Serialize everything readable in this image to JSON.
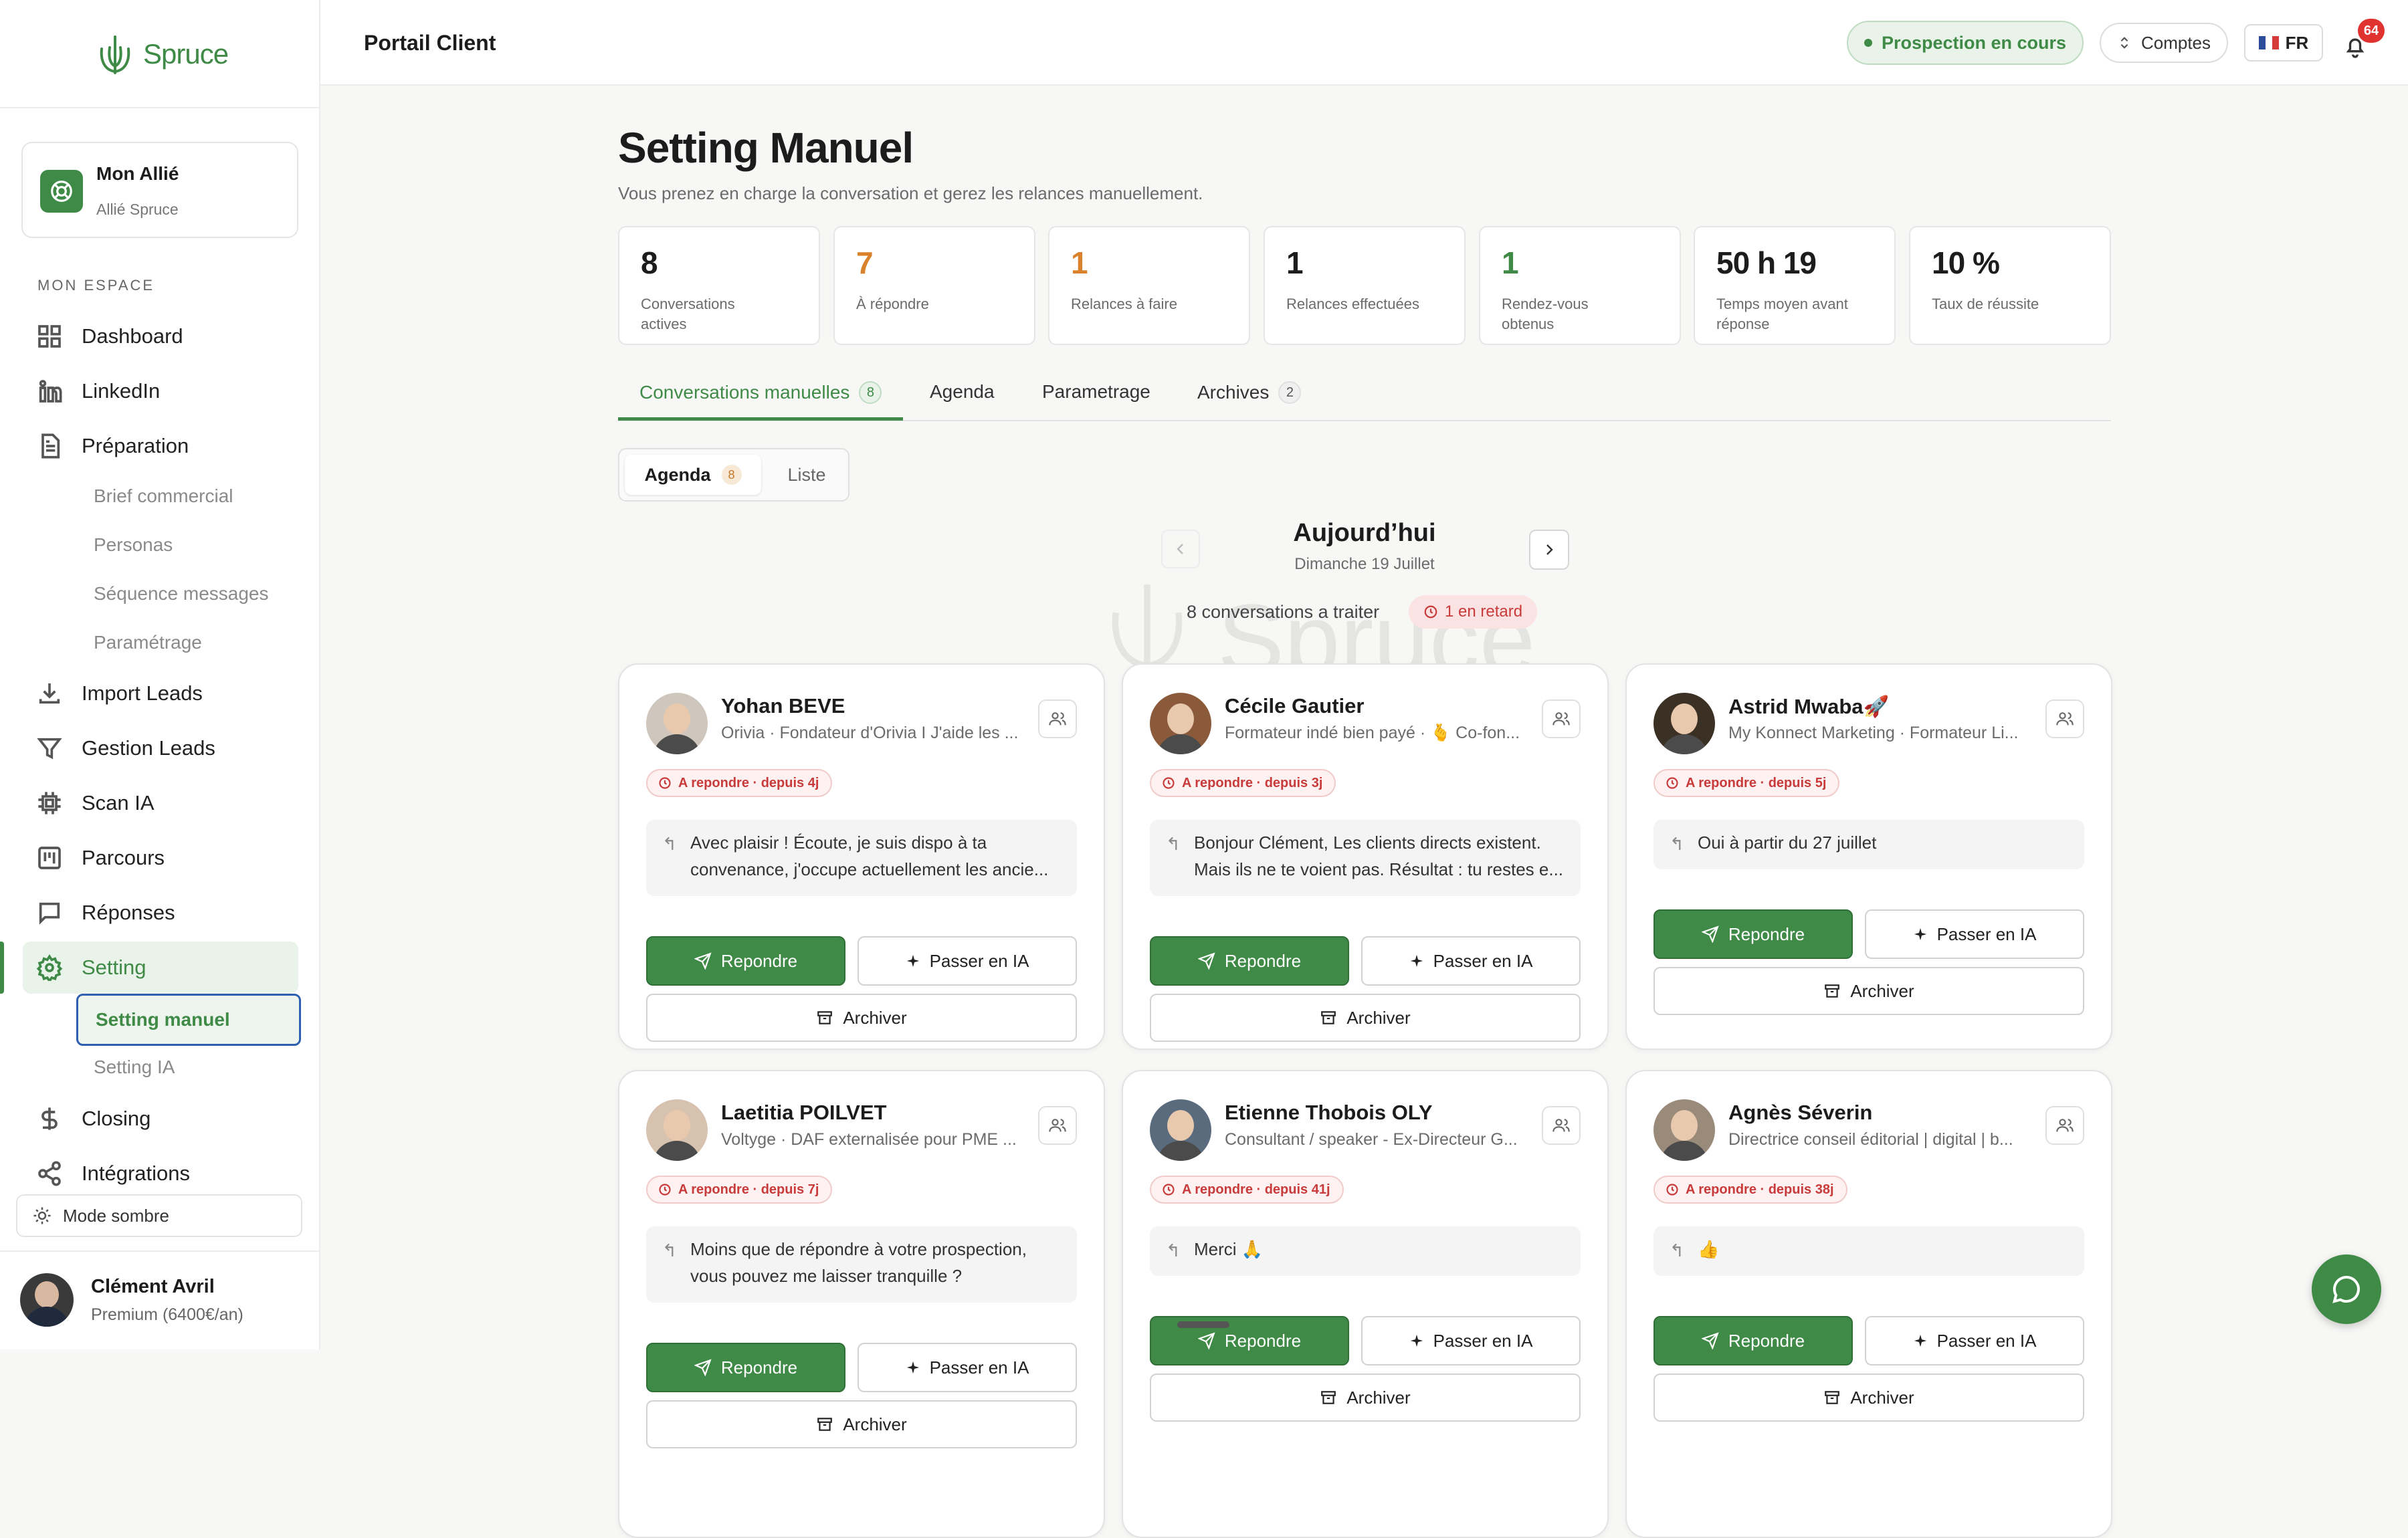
{
  "sidebar": {
    "logo_text": "Spruce",
    "ally": {
      "name": "Mon Allié",
      "sub": "Allié Spruce"
    },
    "section_label": "MON ESPACE",
    "items": [
      {
        "label": "Dashboard",
        "icon": "grid-icon"
      },
      {
        "label": "LinkedIn",
        "icon": "linkedin-icon"
      },
      {
        "label": "Préparation",
        "icon": "document-icon"
      },
      {
        "label": "Import Leads",
        "icon": "download-icon"
      },
      {
        "label": "Gestion Leads",
        "icon": "filter-icon"
      },
      {
        "label": "Scan IA",
        "icon": "chip-icon"
      },
      {
        "label": "Parcours",
        "icon": "kanban-icon"
      },
      {
        "label": "Réponses",
        "icon": "chat-icon"
      },
      {
        "label": "Setting",
        "icon": "gear-icon"
      },
      {
        "label": "Closing",
        "icon": "dollar-icon"
      },
      {
        "label": "Intégrations",
        "icon": "share-icon"
      }
    ],
    "prep_subitems": [
      "Brief commercial",
      "Personas",
      "Séquence messages",
      "Paramétrage"
    ],
    "setting_subitems": [
      "Setting manuel",
      "Setting IA"
    ],
    "dark_mode": "Mode sombre",
    "user": {
      "name": "Clément Avril",
      "plan": "Premium (6400€/an)"
    }
  },
  "topbar": {
    "title": "Portail Client",
    "status": "Prospection en cours",
    "accounts": "Comptes",
    "lang": "FR",
    "notif_count": "64"
  },
  "page": {
    "title": "Setting Manuel",
    "subtitle": "Vous prenez en charge la conversation et gerez les relances manuellement."
  },
  "stats": [
    {
      "value": "8",
      "label": "Conversations actives",
      "color": "#1c1c1c"
    },
    {
      "value": "7",
      "label": "À répondre",
      "color": "#d9822b"
    },
    {
      "value": "1",
      "label": "Relances à faire",
      "color": "#d9822b"
    },
    {
      "value": "1",
      "label": "Relances effectuées",
      "color": "#1c1c1c"
    },
    {
      "value": "1",
      "label": "Rendez-vous obtenus",
      "color": "#3f8a46"
    },
    {
      "value": "50 h 19",
      "label": "Temps moyen avant réponse",
      "color": "#1c1c1c"
    },
    {
      "value": "10 %",
      "label": "Taux de réussite",
      "color": "#1c1c1c"
    }
  ],
  "tabs": [
    {
      "label": "Conversations manuelles",
      "badge": "8"
    },
    {
      "label": "Agenda"
    },
    {
      "label": "Parametrage"
    },
    {
      "label": "Archives",
      "badge": "2"
    }
  ],
  "view_toggle": {
    "agenda": "Agenda",
    "agenda_badge": "8",
    "liste": "Liste"
  },
  "day": {
    "title": "Aujourd’hui",
    "date": "Dimanche 19 Juillet",
    "count": "8 conversations a traiter",
    "late": "1 en retard"
  },
  "actions": {
    "reply": "Repondre",
    "ia": "Passer en IA",
    "archive": "Archiver"
  },
  "cards": [
    {
      "name": "Yohan BEVE",
      "sub": "Orivia · Fondateur d'Orivia I J'aide les ...",
      "badge": "A repondre · depuis 4j",
      "message": "Avec plaisir ! Écoute, je suis dispo à ta convenance, j'occupe actuellement les ancie..."
    },
    {
      "name": "Cécile Gautier",
      "sub": "Formateur indé bien payé · 🫰 Co-fon...",
      "badge": "A repondre · depuis 3j",
      "message": "Bonjour Clément, Les clients directs existent. Mais ils ne te voient pas. Résultat : tu restes e..."
    },
    {
      "name": "Astrid Mwaba🚀",
      "sub": "My Konnect Marketing · Formateur Li...",
      "badge": "A repondre · depuis 5j",
      "message": "Oui à partir du 27 juillet"
    },
    {
      "name": "Laetitia POILVET",
      "sub": "Voltyge · DAF externalisée pour PME ...",
      "badge": "A repondre · depuis 7j",
      "message": "Moins que de répondre à votre prospection, vous pouvez me laisser tranquille ?"
    },
    {
      "name": "Etienne Thobois OLY",
      "sub": "Consultant / speaker - Ex-Directeur G...",
      "badge": "A repondre · depuis 41j",
      "message": "Merci 🙏"
    },
    {
      "name": "Agnès Séverin",
      "sub": "Directrice conseil éditorial | digital | b...",
      "badge": "A repondre · depuis 38j",
      "message": "👍"
    }
  ],
  "colors": {
    "brand_green": "#3f8a46",
    "late_red": "#c93a3a",
    "orange": "#d9822b",
    "notif_red": "#e0322f"
  }
}
